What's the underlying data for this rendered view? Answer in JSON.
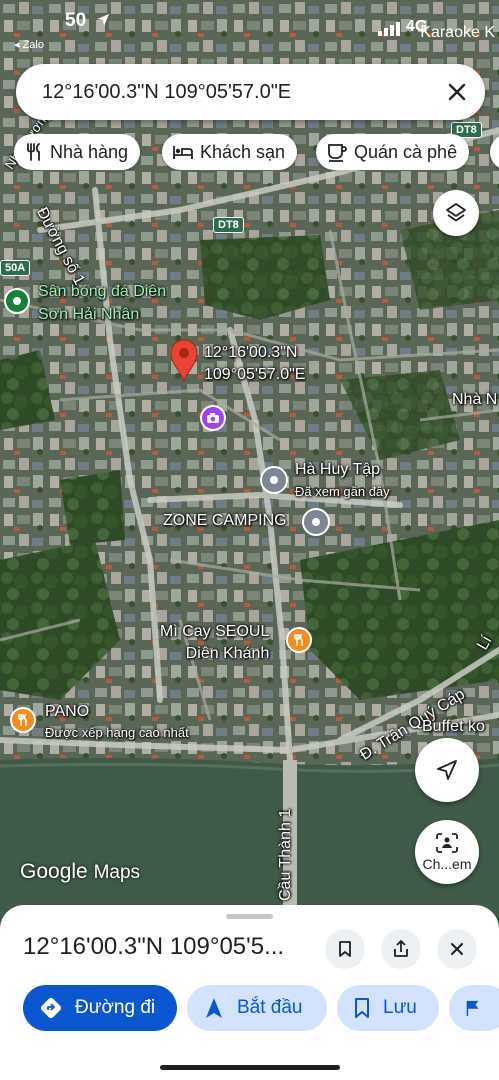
{
  "status_bar": {
    "time": "50",
    "back_app": "◂ Zalo",
    "carrier_overlay": "Karaoke K",
    "signal_text": "4G"
  },
  "search": {
    "query": "12°16'00.3\"N 109°05'57.0\"E"
  },
  "chips": [
    {
      "label": "Nhà hàng",
      "icon": "fork-knife-icon"
    },
    {
      "label": "Khách sạn",
      "icon": "bed-icon"
    },
    {
      "label": "Quán cà phê",
      "icon": "coffee-icon"
    }
  ],
  "map": {
    "dropped_pin_label_line1": "12°16'00.3\"N",
    "dropped_pin_label_line2": "109°05'57.0\"E",
    "places": {
      "san_bong_line1": "Sân bóng đá Diên",
      "san_bong_line2": "Sơn Hải Nhân",
      "ha_huy_tap": "Hà Huy Tập",
      "ha_huy_tap_sub": "Đã xem gần đây",
      "zone": "ZONE CAMPING",
      "mi_cay_line1": "Mì Cay SEOUL",
      "mi_cay_line2": "Diên Khánh",
      "pano": "PANO",
      "pano_sub": "Được xếp hạng cao nhất",
      "buffet": "Buffet ko",
      "nha_n": "Nhà N"
    },
    "roads": {
      "duong_so_1": "Đường số 1",
      "dt8_a": "DT8",
      "dt8_b": "DT8",
      "r50a": "50A",
      "tran_quy_cap": "Đ. Trần Quý Cáp",
      "cau_thanh_1": "Cầu Thành 1",
      "nha_vuong": "Nhà Vương",
      "li": "Lí"
    },
    "watermark_google": "Google",
    "watermark_maps": "Maps",
    "streetview_label": "Ch...em"
  },
  "sheet": {
    "coord": "12°16'00.3\"N 109°05'5...",
    "actions": [
      {
        "label": "Đường đi",
        "icon": "directions-icon",
        "style": "primary"
      },
      {
        "label": "Bắt đầu",
        "icon": "navigation-arrow-icon",
        "style": "secondary"
      },
      {
        "label": "Lưu",
        "icon": "bookmark-icon",
        "style": "secondary"
      }
    ]
  },
  "colors": {
    "pin_red": "#ea4335",
    "primary_blue": "#0b57d0",
    "secondary_blue": "#d3e3fd",
    "poi_orange": "#f58c1f",
    "poi_purple": "#a142f4",
    "poi_green": "#188038",
    "poi_grey": "#7b8893"
  }
}
